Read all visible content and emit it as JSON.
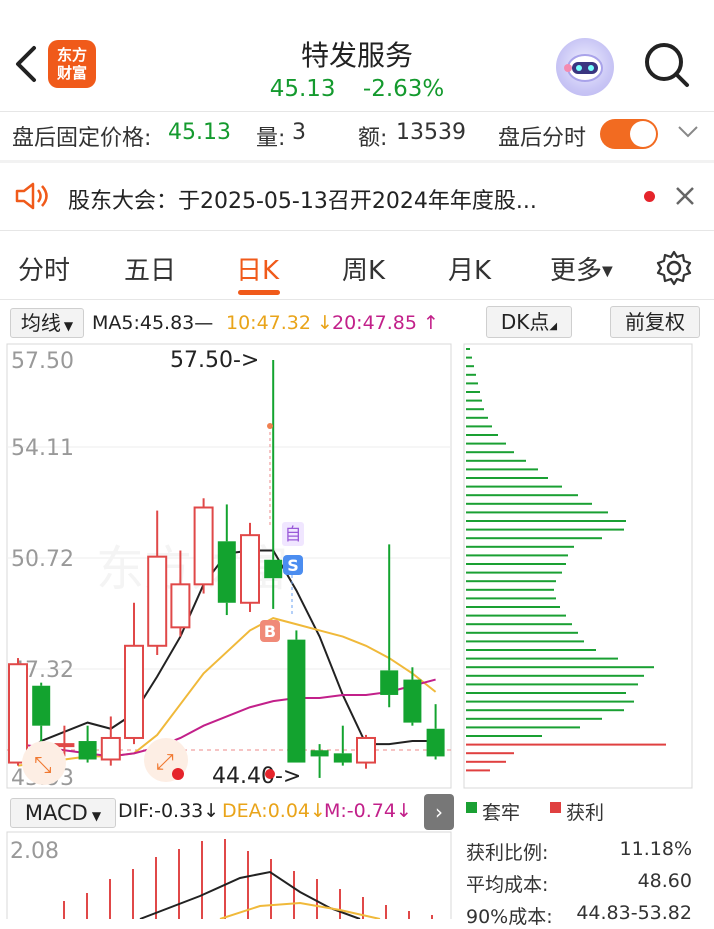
{
  "header": {
    "logo_line1": "东方",
    "logo_line2": "财富",
    "title": "特发服务",
    "price": "45.13",
    "change_pct": "-2.63%"
  },
  "after_hours": {
    "fixed_price_label": "盘后固定价格:",
    "fixed_price": "45.13",
    "volume_label": "量:",
    "volume": "3",
    "amount_label": "额:",
    "amount": "13539",
    "timeshare_label": "盘后分时",
    "timeshare_on": true
  },
  "notice": {
    "text": "股东大会：于2025-05-13召开2024年年度股..."
  },
  "tabs": [
    {
      "label": "分时"
    },
    {
      "label": "五日"
    },
    {
      "label": "日K",
      "active": true
    },
    {
      "label": "周K"
    },
    {
      "label": "月K"
    },
    {
      "label": "更多"
    }
  ],
  "ma_bar": {
    "selector": "均线",
    "ma5": "MA5:45.83—",
    "ma10": "10:47.32",
    "ma20": "20:47.85",
    "dk_button": "DK点",
    "adjust_button": "前复权"
  },
  "kline": {
    "y_labels": [
      "57.50",
      "54.11",
      "50.72",
      "47.32",
      "43.93"
    ],
    "high_annotation": "57.50->",
    "low_annotation": "44.40->",
    "watermark": "东方财富",
    "marker_auto": "自",
    "marker_s": "S",
    "marker_b": "B",
    "candles": [
      {
        "o": 44.4,
        "c": 47.6,
        "h": 47.8,
        "l": 44.3
      },
      {
        "o": 46.9,
        "c": 45.6,
        "h": 47.0,
        "l": 44.7
      },
      {
        "o": 45.0,
        "c": 45.0,
        "h": 45.6,
        "l": 44.6
      },
      {
        "o": 45.1,
        "c": 44.5,
        "h": 45.6,
        "l": 44.4
      },
      {
        "o": 44.5,
        "c": 45.2,
        "h": 45.9,
        "l": 44.3
      },
      {
        "o": 45.2,
        "c": 48.2,
        "h": 49.6,
        "l": 45.0
      },
      {
        "o": 48.2,
        "c": 51.1,
        "h": 52.6,
        "l": 47.9
      },
      {
        "o": 48.8,
        "c": 50.2,
        "h": 51.3,
        "l": 48.5
      },
      {
        "o": 50.2,
        "c": 52.7,
        "h": 53.0,
        "l": 49.9
      },
      {
        "o": 51.6,
        "c": 49.6,
        "h": 52.8,
        "l": 49.2
      },
      {
        "o": 49.6,
        "c": 51.8,
        "h": 52.2,
        "l": 49.3
      },
      {
        "o": 51.0,
        "c": 50.4,
        "h": 57.5,
        "l": 49.4
      },
      {
        "o": 48.4,
        "c": 44.4,
        "h": 48.7,
        "l": 44.4
      },
      {
        "o": 44.8,
        "c": 44.6,
        "h": 45.0,
        "l": 43.9
      },
      {
        "o": 44.7,
        "c": 44.4,
        "h": 45.6,
        "l": 44.3
      },
      {
        "o": 44.4,
        "c": 45.2,
        "h": 45.3,
        "l": 44.2
      },
      {
        "o": 47.4,
        "c": 46.6,
        "h": 51.5,
        "l": 46.2
      },
      {
        "o": 47.1,
        "c": 45.7,
        "h": 47.5,
        "l": 45.6
      },
      {
        "o": 45.5,
        "c": 44.6,
        "h": 46.3,
        "l": 44.5
      }
    ],
    "ma5": [
      44.5,
      45.1,
      45.4,
      45.7,
      45.5,
      46.0,
      47.2,
      48.5,
      50.2,
      51.2,
      51.3,
      51.3,
      50.0,
      48.5,
      46.6,
      45.0,
      45.0,
      45.1,
      45.1
    ],
    "ma10": [
      44.3,
      44.4,
      44.5,
      44.6,
      44.6,
      44.7,
      45.3,
      46.3,
      47.3,
      48.0,
      48.7,
      49.1,
      48.9,
      48.7,
      48.5,
      48.2,
      47.8,
      47.3,
      46.7
    ],
    "ma20": [
      45.0,
      44.9,
      44.8,
      44.7,
      44.6,
      44.7,
      44.9,
      45.2,
      45.6,
      45.9,
      46.2,
      46.4,
      46.5,
      46.5,
      46.6,
      46.6,
      46.7,
      46.9,
      47.1
    ]
  },
  "chips": {
    "legend_hold": "套牢",
    "legend_profit": "获利",
    "profit_ratio_label": "获利比例:",
    "profit_ratio": "11.18%",
    "avg_cost_label": "平均成本:",
    "avg_cost": "48.60",
    "cost90_label": "90%成本:",
    "cost90": "44.83-53.82",
    "green_color": "#1aa033",
    "red_color": "#e04040"
  },
  "macd": {
    "selector": "MACD",
    "dif": "DIF:-0.33↓",
    "dea": "DEA:0.04↓",
    "m": "M:-0.74↓",
    "y_top": "2.08"
  },
  "colors": {
    "up": "#e04848",
    "down": "#13a32f",
    "accent": "#f05a1a",
    "ma5": "#222222",
    "ma10": "#f0b93a",
    "ma20": "#c2208a"
  }
}
